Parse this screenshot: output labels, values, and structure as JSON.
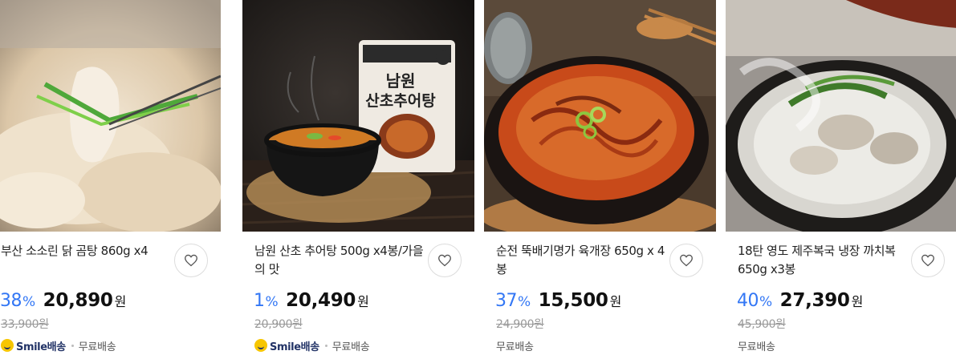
{
  "products": [
    {
      "title": "부산 소소린 닭 곰탕 860g x4",
      "discount": "38",
      "discount_unit": "%",
      "price": "20,890",
      "currency": "원",
      "original_price": "33,900원",
      "smile_label": "Smile배송",
      "shipping": "무료배송",
      "has_smile": true
    },
    {
      "title": "남원 산초 추어탕 500g x4봉/가을의 맛",
      "discount": "1",
      "discount_unit": "%",
      "price": "20,490",
      "currency": "원",
      "original_price": "20,900원",
      "smile_label": "Smile배송",
      "shipping": "무료배송",
      "has_smile": true,
      "package_line1": "남원",
      "package_line2": "산초추어탕"
    },
    {
      "title": "순전 뚝배기명가 육개장 650g x 4봉",
      "discount": "37",
      "discount_unit": "%",
      "price": "15,500",
      "currency": "원",
      "original_price": "24,900원",
      "shipping": "무료배송",
      "has_smile": false
    },
    {
      "title": "18탄 영도 제주복국 냉장 까치복 650g x3봉",
      "discount": "40",
      "discount_unit": "%",
      "price": "27,390",
      "currency": "원",
      "original_price": "45,900원",
      "shipping": "무료배송",
      "has_smile": false
    }
  ],
  "icons": {
    "wishlist": "heart-outline-icon",
    "smile_badge": "smile-face-icon"
  },
  "colors": {
    "discount": "#3377f5",
    "smile_yellow": "#f7c600",
    "smile_navy": "#223366"
  }
}
